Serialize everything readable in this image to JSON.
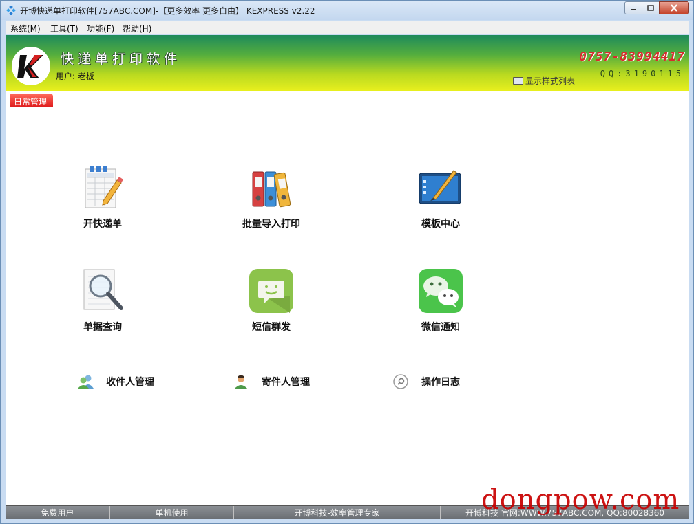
{
  "window": {
    "title": "开博快递单打印软件[757ABC.COM]-【更多效率 更多自由】 KEXPRESS v2.22"
  },
  "menu": [
    "系统(M)",
    "工具(T)",
    "功能(F)",
    "帮助(H)"
  ],
  "header": {
    "logo_letter": "K",
    "app_name": "快递单打印软件",
    "user_label": "用户: 老板",
    "phone": "0757-83994417",
    "qq": "QQ:3190115",
    "show_style_label": "显示样式列表"
  },
  "tabs": [
    {
      "label": "日常管理",
      "active": true
    }
  ],
  "tiles": [
    {
      "label": "开快递单",
      "icon": "spreadsheet-pencil-icon"
    },
    {
      "label": "批量导入打印",
      "icon": "binders-icon"
    },
    {
      "label": "模板中心",
      "icon": "tablet-pen-icon"
    },
    {
      "label": "单据查询",
      "icon": "magnifier-document-icon"
    },
    {
      "label": "短信群发",
      "icon": "sms-chat-icon"
    },
    {
      "label": "微信通知",
      "icon": "wechat-icon"
    }
  ],
  "links": [
    {
      "label": "收件人管理",
      "icon": "recipients-icon"
    },
    {
      "label": "寄件人管理",
      "icon": "sender-icon"
    },
    {
      "label": "操作日志",
      "icon": "search-log-icon"
    }
  ],
  "status": [
    "免费用户",
    "单机使用",
    "开博科技-效率管理专家",
    "开博科技 官网:WWW.757ABC.COM, QQ:80028360"
  ],
  "watermark": "dongpow.com",
  "colors": {
    "banner_top": "#1e8a5c",
    "banner_bottom": "#e8ef1e",
    "phone": "#d62d2d",
    "tab": "#e01e1e",
    "sms_green": "#8cc34b",
    "wechat_green": "#4bc44b"
  }
}
